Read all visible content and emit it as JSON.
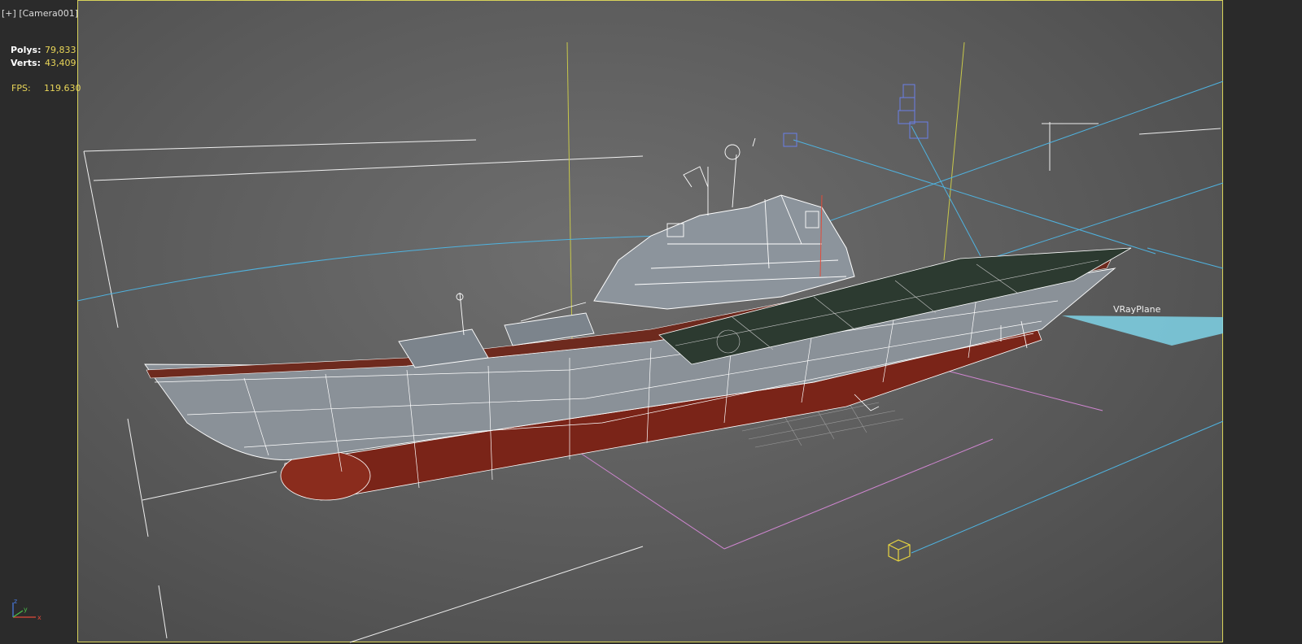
{
  "viewport": {
    "label_plus": "[+]",
    "label_camera": "[Camera001]"
  },
  "stats": {
    "polys_label": "Polys:",
    "polys_value": "79,833",
    "verts_label": "Verts:",
    "verts_value": "43,409",
    "fps_label": "FPS:",
    "fps_value": "119.630"
  },
  "objects": {
    "vray_plane_label": "VRayPlane"
  },
  "axis": {
    "x": "x",
    "y": "y",
    "z": "z"
  },
  "colors": {
    "safe_frame": "#d8d35a",
    "camera_lines": "#4fb3e0",
    "light_plane": "#6ccde6",
    "selection_lines": "#d07ad0",
    "wireframe": "#ffffff",
    "hull_red": "#7a2418"
  }
}
